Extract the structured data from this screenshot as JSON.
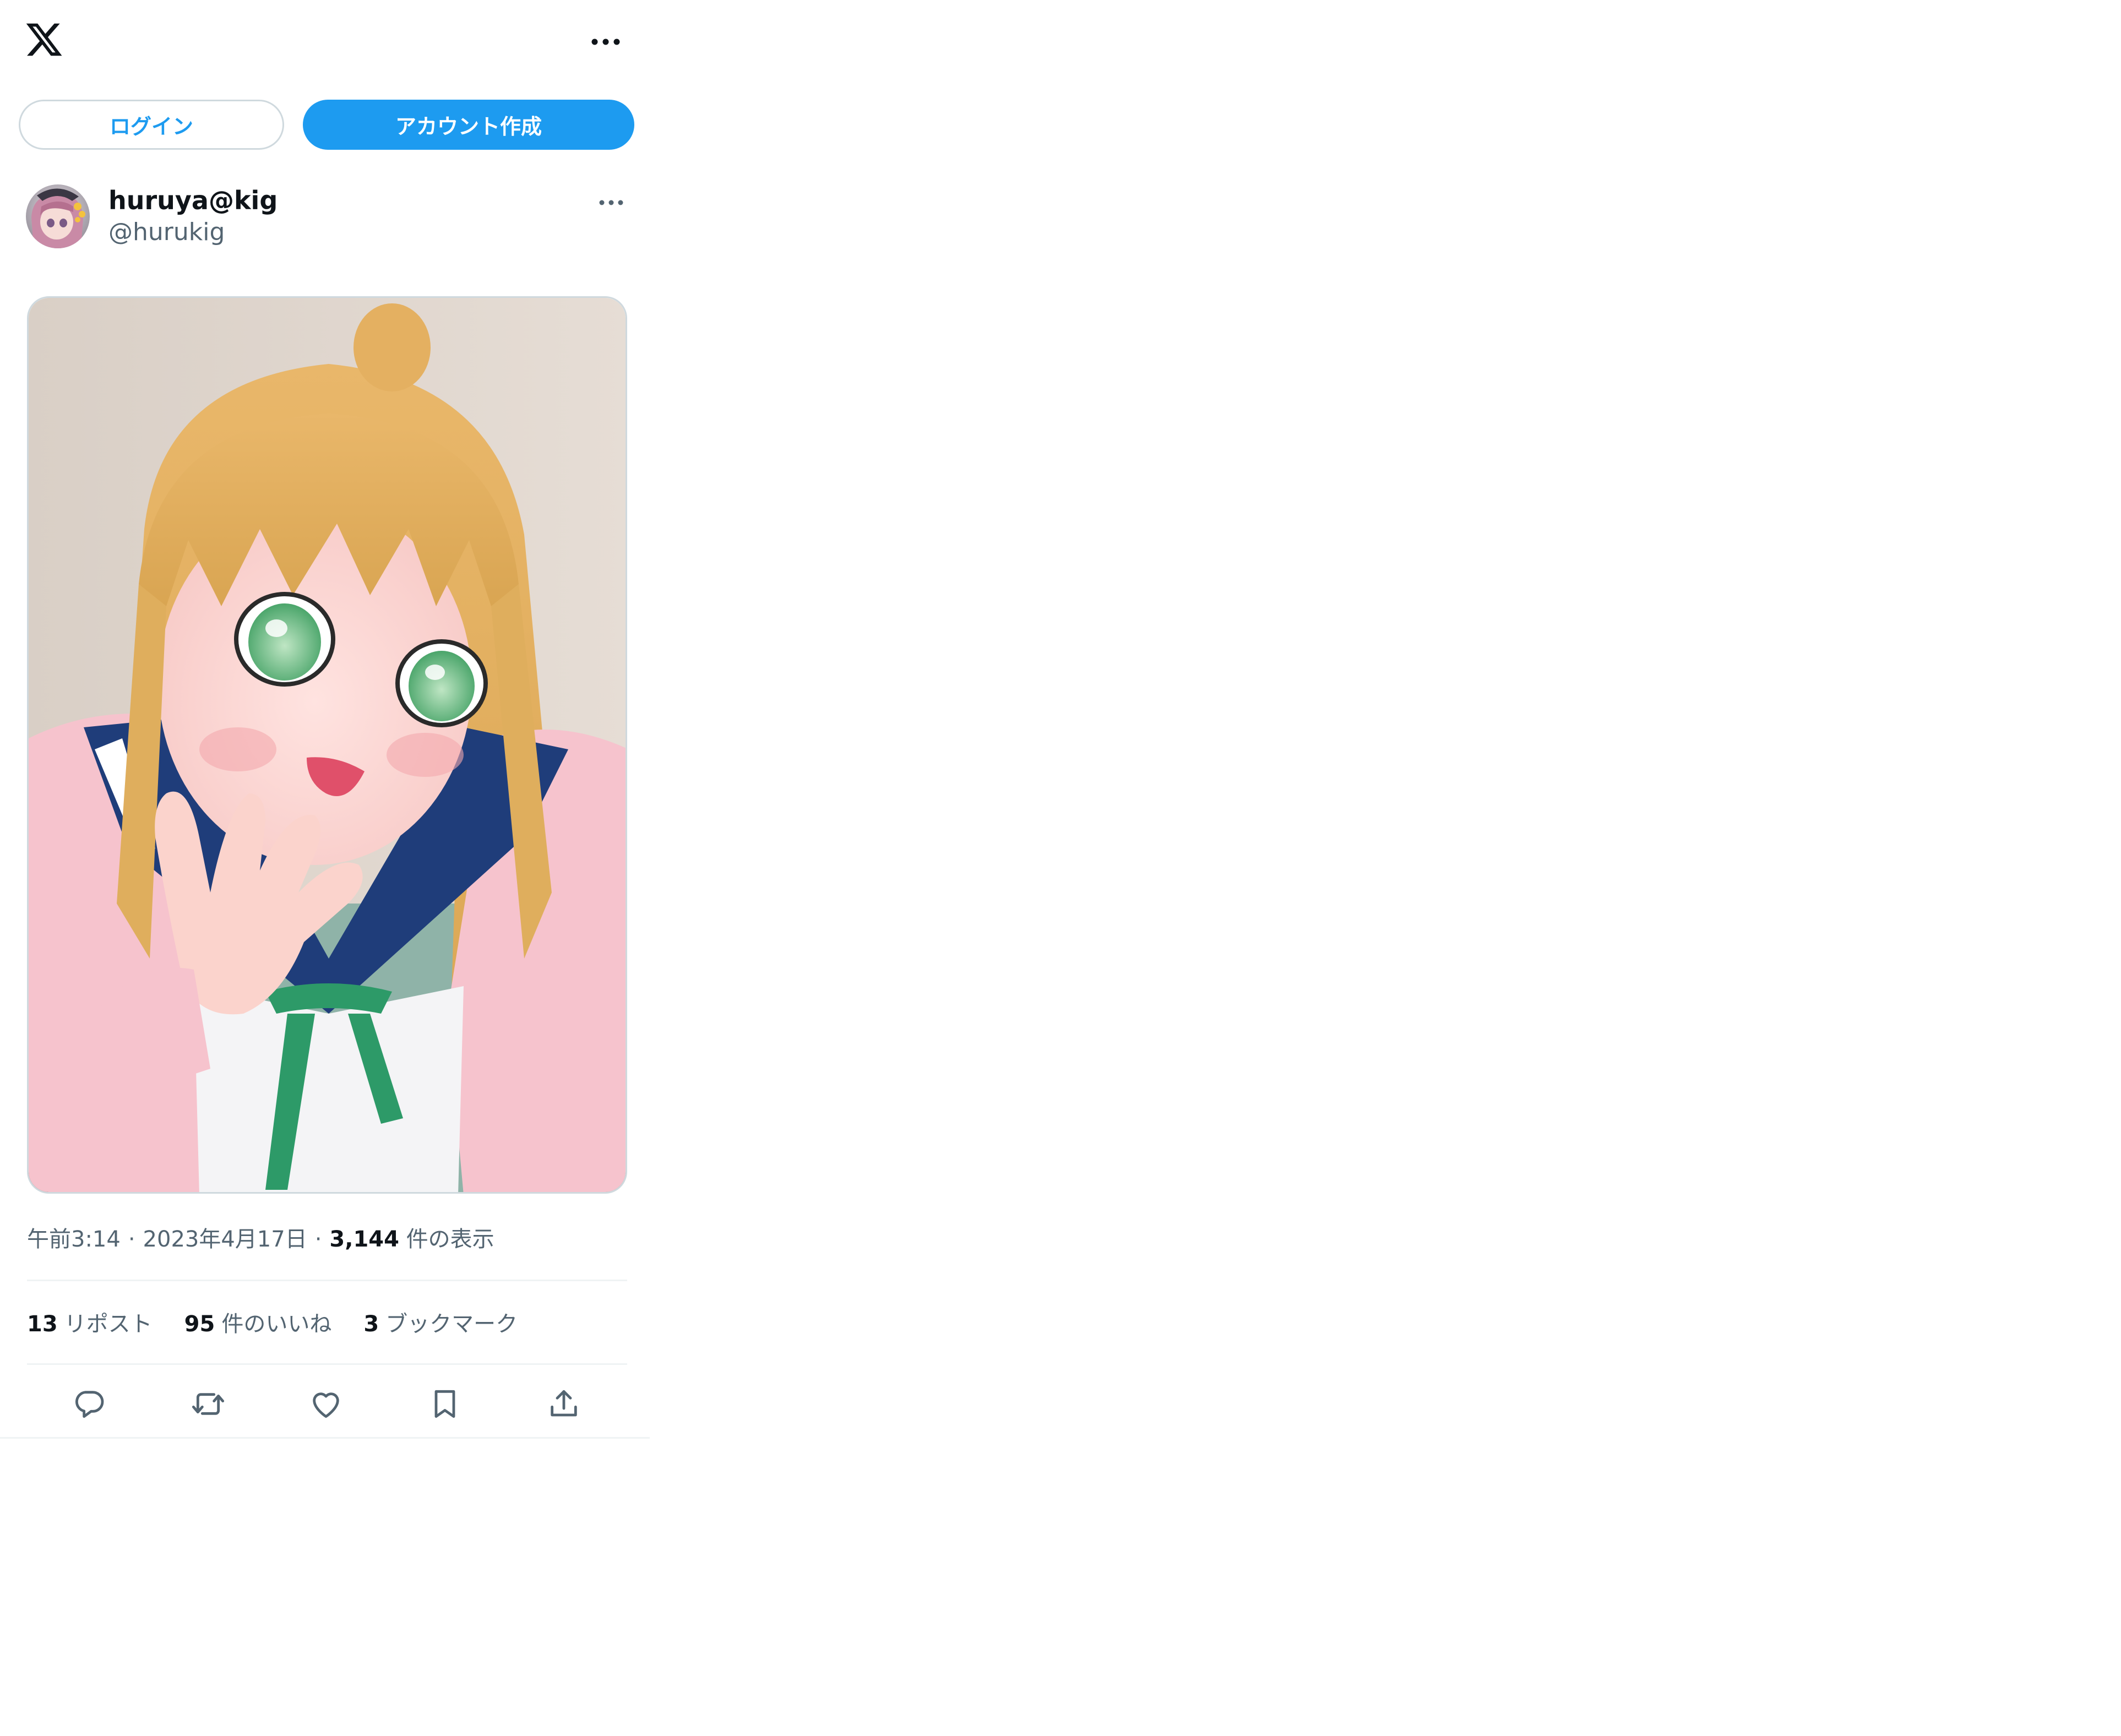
{
  "header": {
    "logo_icon": "x-logo-icon",
    "more_icon": "more-horizontal-icon"
  },
  "auth": {
    "login_label": "ログイン",
    "signup_label": "アカウント作成",
    "accent_color": "#1d9bf0"
  },
  "tweet": {
    "author": {
      "name": "huruya@kig",
      "handle": "@hurukig"
    },
    "media_description_icon": "photo",
    "meta": {
      "time": "午前3:14",
      "date": "2023年4月17日",
      "separator": "·",
      "views_count": "3,144",
      "views_label": "件の表示"
    },
    "stats": [
      {
        "count": "13",
        "label": "リポスト"
      },
      {
        "count": "95",
        "label": "件のいいね"
      },
      {
        "count": "3",
        "label": "ブックマーク"
      }
    ],
    "actions": [
      {
        "name": "reply",
        "icon": "reply-icon"
      },
      {
        "name": "repost",
        "icon": "repost-icon"
      },
      {
        "name": "like",
        "icon": "heart-icon"
      },
      {
        "name": "bookmark",
        "icon": "bookmark-icon"
      },
      {
        "name": "share",
        "icon": "share-icon"
      }
    ]
  }
}
